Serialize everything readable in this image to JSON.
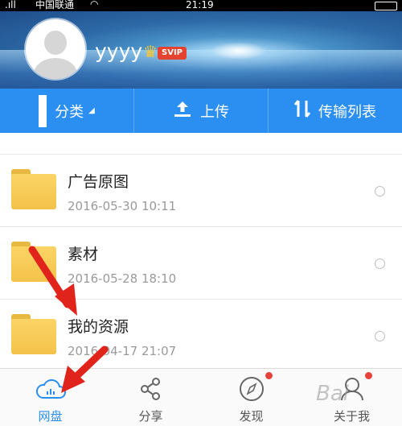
{
  "status_bar": {
    "signal": ".ıll",
    "carrier": "中国联通",
    "time": "21:19"
  },
  "profile": {
    "username": "yyyy",
    "badge": "SVIP"
  },
  "toolbar": {
    "category_label": "分类",
    "upload_label": "上传",
    "transfer_label": "传输列表"
  },
  "files": [
    {
      "name": "广告原图",
      "date": "2016-05-30  10:11"
    },
    {
      "name": "素材",
      "date": "2016-05-28  18:10"
    },
    {
      "name": "我的资源",
      "date": "2016-04-17  21:07"
    }
  ],
  "bottom_nav": {
    "items": [
      {
        "label": "网盘",
        "icon": "cloud-icon",
        "active": true
      },
      {
        "label": "分享",
        "icon": "share-icon"
      },
      {
        "label": "发现",
        "icon": "compass-icon"
      },
      {
        "label": "关于我",
        "icon": "user-icon"
      }
    ]
  },
  "watermark": "Bai",
  "colors": {
    "accent": "#2a8ff0",
    "notification_dot": "#e8433b",
    "annotation_arrow": "#e0231b",
    "folder": "#f4c24a"
  }
}
